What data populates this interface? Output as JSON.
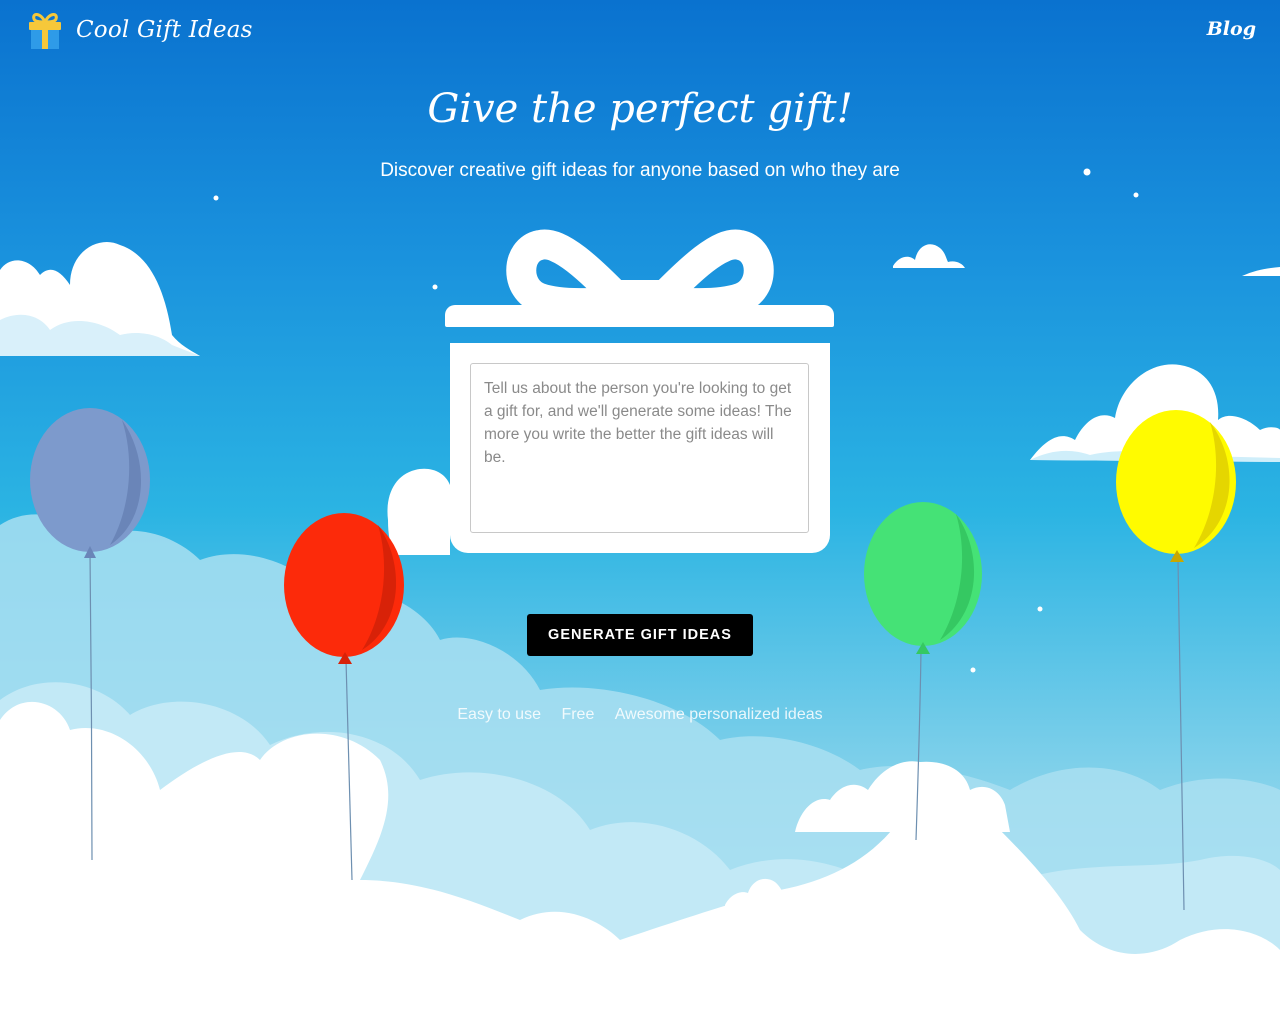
{
  "header": {
    "app_name": "Cool Gift Ideas",
    "blog_link": "Blog",
    "logo_icon": "gift-icon"
  },
  "hero": {
    "title": "Give the perfect gift!",
    "subtitle": "Discover creative gift ideas for anyone based on who they are"
  },
  "gift_form": {
    "placeholder": "Tell us about the person you're looking to get a gift for, and we'll generate some ideas! The more you write the better the gift ideas will be.",
    "value": "",
    "submit_label": "GENERATE GIFT IDEAS"
  },
  "features": [
    "Easy to use",
    "Free",
    "Awesome personalized ideas"
  ],
  "colors": {
    "sky_top": "#0a72cf",
    "sky_bottom": "#c9ecf6",
    "button_bg": "#000000",
    "balloon_purple": "#7d9acc",
    "balloon_red": "#fc2a0a",
    "balloon_green": "#45e276",
    "balloon_yellow": "#fffb00"
  }
}
